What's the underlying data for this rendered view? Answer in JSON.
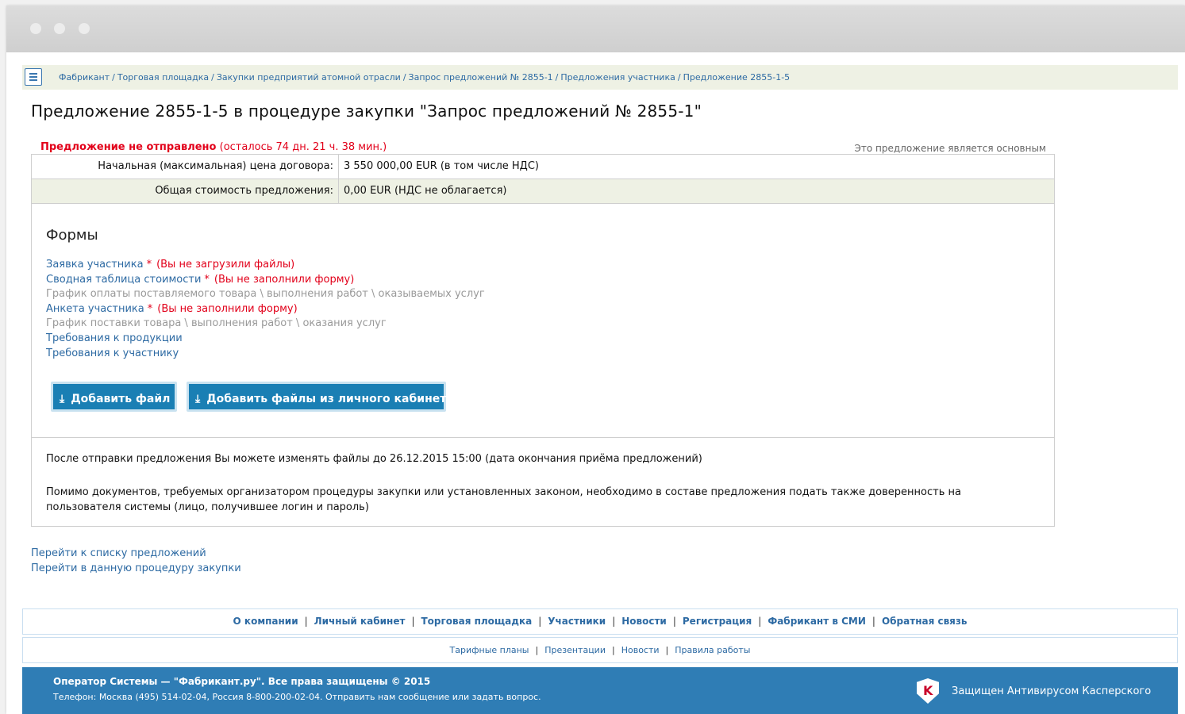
{
  "breadcrumb": [
    "Фабрикант",
    "Торговая площадка",
    "Закупки предприятий атомной отрасли",
    "Запрос предложений № 2855-1",
    "Предложения участника",
    "Предложение 2855-1-5"
  ],
  "page_title": "Предложение 2855-1-5 в процедуре закупки \"Запрос предложений № 2855-1\"",
  "status": {
    "label": "Предложение не отправлено",
    "remaining": "(осталось 74 дн. 21 ч. 38 мин.)",
    "main_offer_note": "Это предложение является основным"
  },
  "price": {
    "initial_label": "Начальная (максимальная) цена договора:",
    "initial_value": "3 550 000,00 EUR (в том числе НДС)",
    "total_label": "Общая стоимость предложения:",
    "total_value": "0,00 EUR (НДС не облагается)"
  },
  "forms": {
    "title": "Формы",
    "items": [
      {
        "label": "Заявка участника",
        "required": "*",
        "error": "(Вы не загрузили файлы)"
      },
      {
        "label": "Сводная таблица стоимости",
        "required": "*",
        "error": "(Вы не заполнили форму)"
      },
      {
        "label": "График оплаты поставляемого товара \\ выполнения работ \\ оказываемых услуг"
      },
      {
        "label": "Анкета участника",
        "required": "*",
        "error": "(Вы не заполнили форму)"
      },
      {
        "label": "График поставки товара \\ выполнения работ \\ оказания услуг"
      },
      {
        "label": "Требования к продукции"
      },
      {
        "label": "Требования к участнику"
      }
    ]
  },
  "buttons": {
    "add_file": "Добавить файл",
    "add_from_cabinet": "Добавить файлы из личного кабинета",
    "icon": "download-icon"
  },
  "notes": {
    "edit_deadline": "После отправки предложения Вы можете изменять файлы до 26.12.2015 15:00 (дата окончания приёма предложений)",
    "power_of_attorney": "Помимо документов, требуемых организатором процедуры закупки или установленных законом, необходимо в составе предложения подать также доверенность на пользователя системы (лицо, получившее логин и пароль)"
  },
  "links": {
    "to_offers": "Перейти к списку предложений",
    "to_procedure": "Перейти в данную процедуру закупки"
  },
  "footer_nav_main": [
    "О компании",
    "Личный кабинет",
    "Торговая площадка",
    "Участники",
    "Новости",
    "Регистрация",
    "Фабрикант в СМИ",
    "Обратная связь"
  ],
  "footer_nav_secondary": [
    "Тарифные планы",
    "Презентации",
    "Новости",
    "Правила работы"
  ],
  "footer": {
    "copyright": "Оператор Системы — \"Фабрикант.ру\". Все права защищены © 2015",
    "contacts": "Телефон: Москва (495) 514-02-04, Россия 8-800-200-02-04. Отправить нам сообщение или задать вопрос.",
    "antivirus": "Защищен Антивирусом Касперского"
  },
  "colors": {
    "link": "#2d6aa3",
    "error": "#e2001a",
    "button": "#1a7fb4",
    "footer": "#2f7db5",
    "row_highlight": "#eef1e4"
  }
}
